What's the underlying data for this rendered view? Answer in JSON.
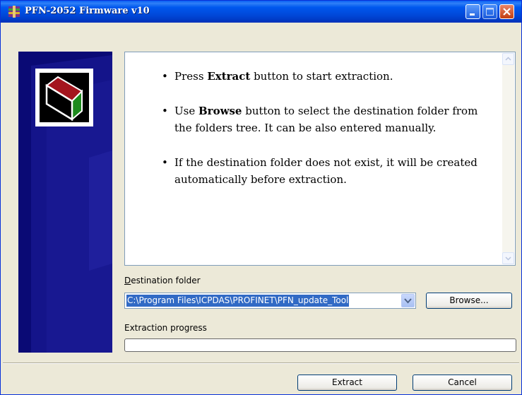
{
  "window": {
    "title": "PFN-2052 Firmware v10",
    "title_icon": "winrar-archive-icon"
  },
  "info": {
    "items": [
      {
        "before": "Press ",
        "bold": "Extract",
        "after": " button to start extraction."
      },
      {
        "before": "Use ",
        "bold": "Browse",
        "after": " button to select the destination folder from the folders tree. It can be also entered manually."
      },
      {
        "before": "",
        "bold": "",
        "after": "If the destination folder does not exist, it will be created automatically before extraction."
      }
    ]
  },
  "destination": {
    "label": "Destination folder",
    "value": "C:\\Program Files\\ICPDAS\\PROFINET\\PFN_update_Tool"
  },
  "buttons": {
    "browse": "Browse...",
    "extract": "Extract",
    "cancel": "Cancel"
  },
  "progress": {
    "label": "Extraction progress",
    "percent": 0
  },
  "colors": {
    "titlebar": "#0058EE",
    "side_panel": "#0A0A75",
    "selection": "#316AC5",
    "dialog_bg": "#ECE9D8"
  }
}
